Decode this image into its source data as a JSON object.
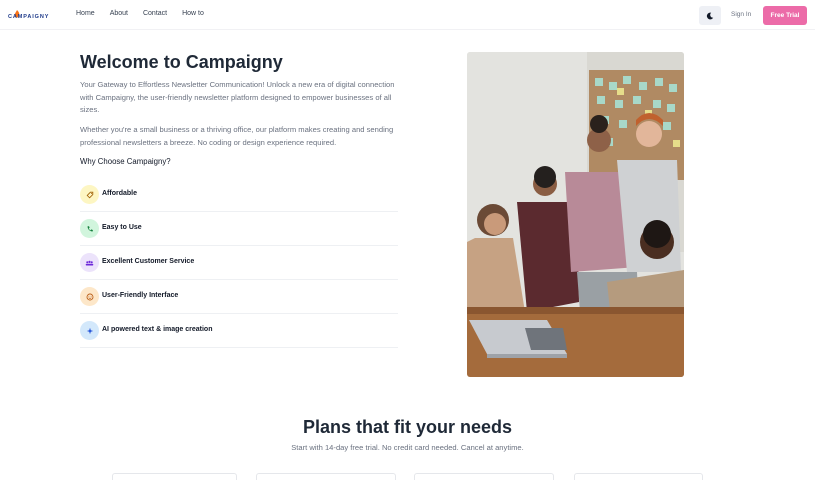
{
  "brand": {
    "logo_text": "CAMPAIGNY",
    "logo_name": "campaigny-logo"
  },
  "nav": {
    "links": [
      "Home",
      "About",
      "Contact",
      "How to"
    ],
    "theme_toggle_icon": "moon-icon",
    "signin_label": "Sign In",
    "trial_label": "Free Trial"
  },
  "hero": {
    "title": "Welcome to Campaigny",
    "paragraph1": "Your Gateway to Effortless Newsletter Communication! Unlock a new era of digital connection with Campaigny, the user-friendly newsletter platform designed to empower businesses of all sizes.",
    "paragraph2": "Whether you're a small business or a thriving office, our platform makes creating and sending professional newsletters a breeze. No coding or design experience required.",
    "why": "Why Choose Campaigny?"
  },
  "features": [
    {
      "label": "Affordable",
      "icon": "tag-icon",
      "bg": "#fdf6c3",
      "fg": "#a16207"
    },
    {
      "label": "Easy to Use",
      "icon": "phone-icon",
      "bg": "#d1f5dd",
      "fg": "#15803d"
    },
    {
      "label": "Excellent Customer Service",
      "icon": "users-icon",
      "bg": "#ece3fb",
      "fg": "#6d28d9"
    },
    {
      "label": "User-Friendly Interface",
      "icon": "smile-icon",
      "bg": "#fde7c9",
      "fg": "#b45309"
    },
    {
      "label": "AI powered text & image creation",
      "icon": "sparkle-icon",
      "bg": "#d3e8fb",
      "fg": "#1d4ed8"
    }
  ],
  "plans": {
    "title": "Plans that fit your needs",
    "subtitle": "Start with 14-day free trial. No credit card needed. Cancel at anytime."
  },
  "colors": {
    "accent": "#ec6ba8",
    "text": "#1f2937",
    "muted": "#6b7280"
  }
}
